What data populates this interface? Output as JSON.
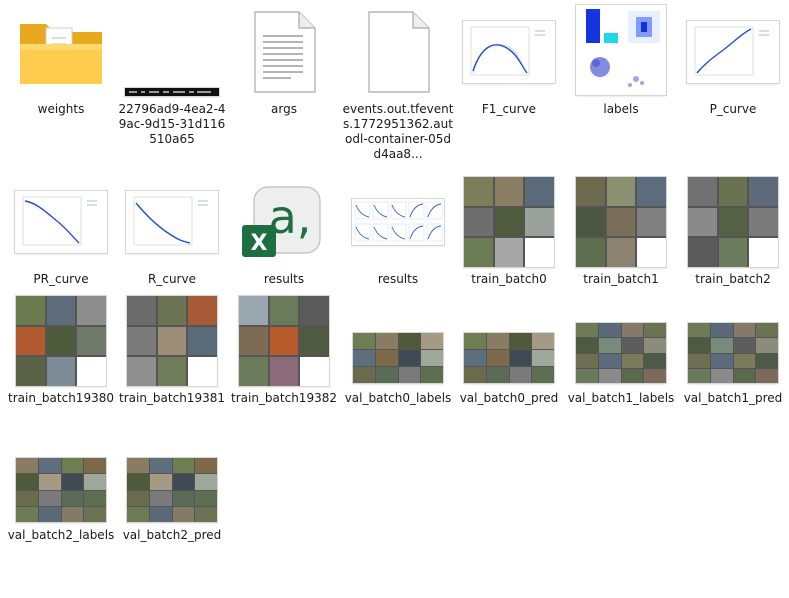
{
  "files": [
    {
      "name": "weights",
      "type": "folder"
    },
    {
      "name": "22796ad9-4ea2-49ac-9d15-31d116510a65",
      "type": "dark-strip"
    },
    {
      "name": "args",
      "type": "document"
    },
    {
      "name": "events.out.tfevents.1772951362.autodl-container-05dd4aa8...",
      "type": "blank-document"
    },
    {
      "name": "F1_curve",
      "type": "curve"
    },
    {
      "name": "labels",
      "type": "labels-plot"
    },
    {
      "name": "P_curve",
      "type": "curve"
    },
    {
      "name": "PR_curve",
      "type": "curve"
    },
    {
      "name": "R_curve",
      "type": "curve"
    },
    {
      "name": "results",
      "type": "excel"
    },
    {
      "name": "results",
      "type": "results-plot"
    },
    {
      "name": "train_batch0",
      "type": "collage"
    },
    {
      "name": "train_batch1",
      "type": "collage"
    },
    {
      "name": "train_batch2",
      "type": "collage"
    },
    {
      "name": "train_batch19380",
      "type": "collage"
    },
    {
      "name": "train_batch19381",
      "type": "collage"
    },
    {
      "name": "train_batch19382",
      "type": "collage"
    },
    {
      "name": "val_batch0_labels",
      "type": "wide-collage"
    },
    {
      "name": "val_batch0_pred",
      "type": "wide-collage"
    },
    {
      "name": "val_batch1_labels",
      "type": "wide-collage"
    },
    {
      "name": "val_batch1_pred",
      "type": "wide-collage"
    },
    {
      "name": "val_batch2_labels",
      "type": "wide-collage"
    },
    {
      "name": "val_batch2_pred",
      "type": "wide-collage"
    }
  ],
  "colors": {
    "folder_back": "#f2b632",
    "folder_front": "#ffd55c",
    "excel_green": "#1d6f42",
    "curve_blue": "#1f4fd6",
    "collage_palette": [
      "#6f7d52",
      "#8a7b63",
      "#4f5a3b",
      "#a49a86",
      "#5d6f7d",
      "#7c6a4a",
      "#3f4a55",
      "#9fa79a"
    ]
  }
}
